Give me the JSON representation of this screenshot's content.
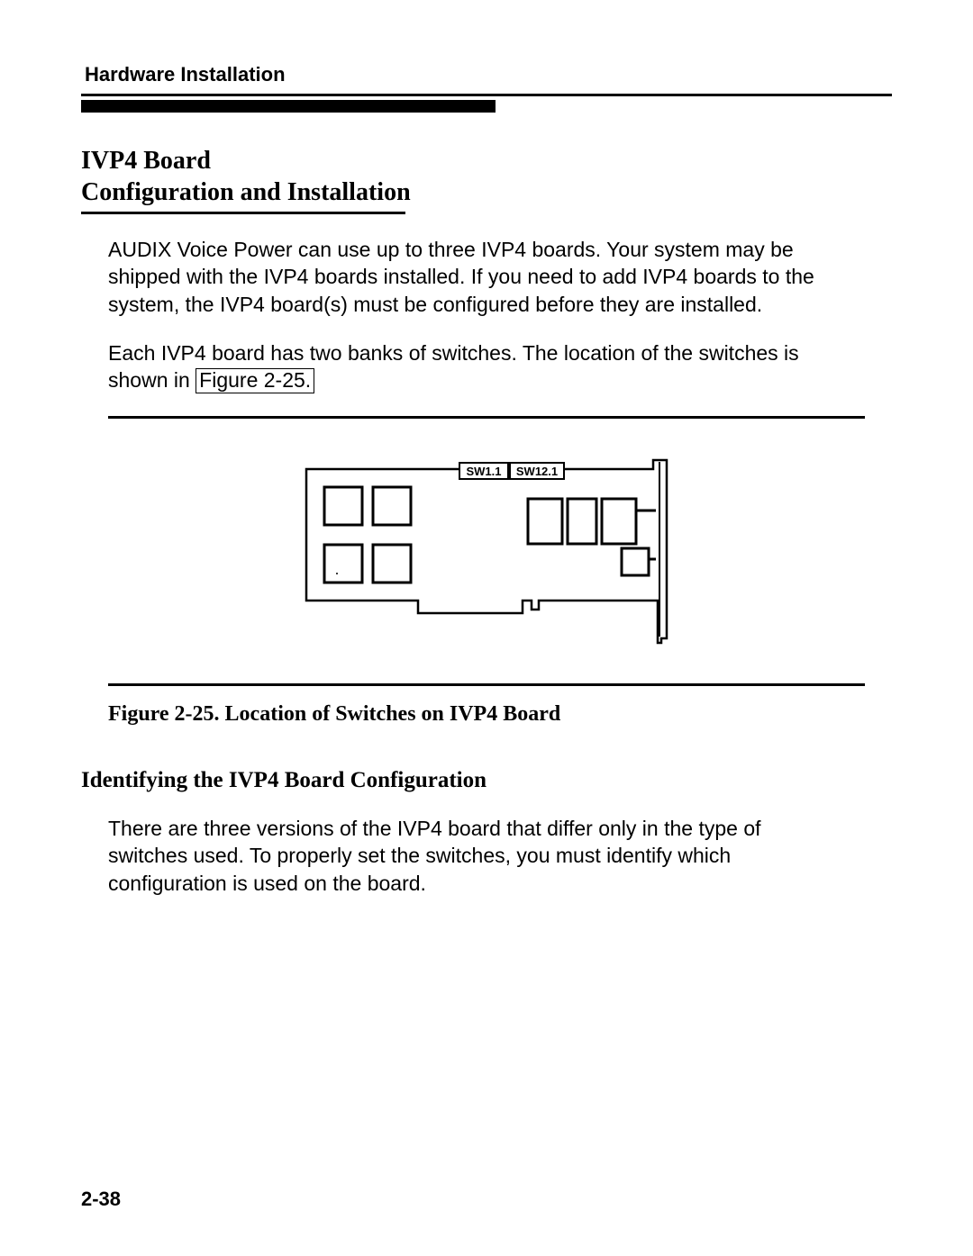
{
  "header": {
    "running_head": "Hardware Installation"
  },
  "section": {
    "title_line1": "IVP4 Board",
    "title_line2": "Configuration and Installation"
  },
  "paragraphs": {
    "p1": "AUDIX Voice Power can use up to three IVP4 boards. Your system may be shipped with the IVP4 boards installed. If you need to add IVP4 boards to the system, the IVP4 board(s) must be configured before they are installed.",
    "p2a": "Each IVP4 board has two banks of switches. The location of the switches is shown in ",
    "p2_ref": "Figure 2-25."
  },
  "figure": {
    "label_sw1": "SW1.1",
    "label_sw12": "SW12.1",
    "caption": "Figure 2-25. Location of Switches on IVP4 Board"
  },
  "subsection": {
    "title": "Identifying the IVP4 Board Configuration",
    "p1": "There are three versions of the IVP4 board that differ only in the type of switches used. To properly set the switches, you must identify which configuration is used on the board."
  },
  "page_number": "2-38"
}
